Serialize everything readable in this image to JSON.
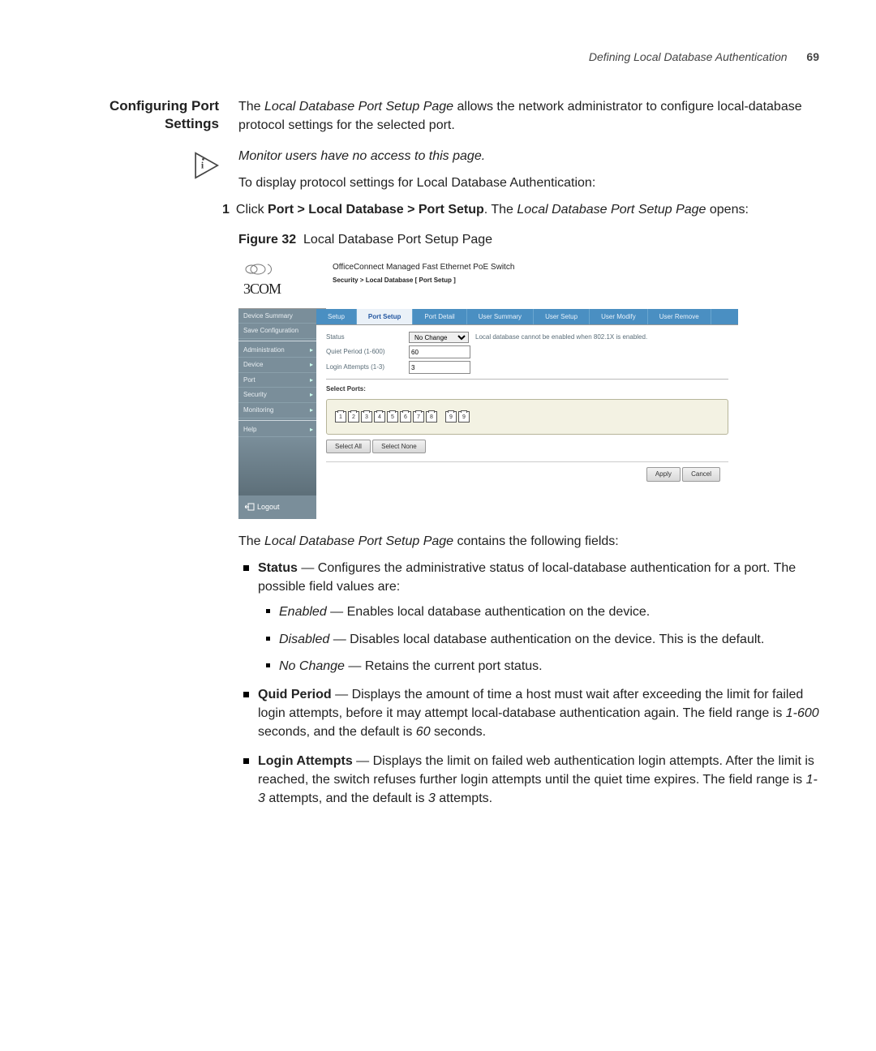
{
  "header": {
    "title": "Defining Local Database Authentication",
    "pagenum": "69"
  },
  "section": {
    "heading_l1": "Configuring Port",
    "heading_l2": "Settings"
  },
  "intro": {
    "p1a": "The ",
    "p1b": "Local Database Port Setup Page",
    "p1c": " allows the network administrator to configure local-database protocol settings for the selected port.",
    "note": "Monitor users have no access to this page.",
    "p2": "To display protocol settings for Local Database Authentication:"
  },
  "step": {
    "num": "1",
    "a": "Click ",
    "b": "Port > Local Database > Port Setup",
    "c": ". The ",
    "d": "Local Database Port Setup Page",
    "e": " opens:"
  },
  "figure": {
    "label": "Figure 32",
    "caption": "Local Database Port Setup Page"
  },
  "shot": {
    "brand": "3COM",
    "product": "OfficeConnect Managed Fast Ethernet PoE Switch",
    "crumb": "Security > Local Database [ Port Setup ]",
    "sidebar": {
      "items1": [
        "Device Summary",
        "Save Configuration"
      ],
      "items2": [
        "Administration",
        "Device",
        "Port",
        "Security",
        "Monitoring"
      ],
      "items3": [
        "Help"
      ],
      "logout": "Logout"
    },
    "tabs": [
      "Setup",
      "Port Setup",
      "Port Detail",
      "User Summary",
      "User Setup",
      "User Modify",
      "User Remove"
    ],
    "active_tab": 1,
    "form": {
      "status_label": "Status",
      "status_value": "No Change",
      "status_note": "Local database cannot be enabled when 802.1X is enabled.",
      "quiet_label": "Quiet Period (1-600)",
      "quiet_value": "60",
      "login_label": "Login Attempts (1-3)",
      "login_value": "3",
      "select_ports": "Select Ports:",
      "ports": [
        "1",
        "2",
        "3",
        "4",
        "5",
        "6",
        "7",
        "8",
        "9",
        "9"
      ],
      "select_all": "Select All",
      "select_none": "Select None",
      "apply": "Apply",
      "cancel": "Cancel"
    }
  },
  "after": {
    "p1a": "The ",
    "p1b": "Local Database Port Setup Page",
    "p1c": " contains the following fields:"
  },
  "fields": {
    "status": {
      "name": "Status",
      "desc": " — Configures the administrative status of local-database authentication for a port. The possible field values are:",
      "opts": [
        {
          "name": "Enabled",
          "desc": " — Enables local database authentication on the device."
        },
        {
          "name": "Disabled",
          "desc": " — Disables local database authentication on the device. This is the default."
        },
        {
          "name": "No Change",
          "desc": " — Retains the current port status."
        }
      ]
    },
    "quid": {
      "name": "Quid Period",
      "d1": " — Displays the amount of time a host must wait after exceeding the limit for failed login attempts, before it may attempt local-database authentication again. The field range is ",
      "r1": "1-600",
      "d2": " seconds, and the default is ",
      "r2": "60",
      "d3": " seconds."
    },
    "login": {
      "name": "Login Attempts",
      "d1": " — Displays the limit on failed web authentication login attempts. After the limit is reached, the switch refuses further login attempts until the quiet time expires. The field range is ",
      "r1": "1-3",
      "d2": " attempts, and the default is ",
      "r2": "3",
      "d3": " attempts."
    }
  }
}
